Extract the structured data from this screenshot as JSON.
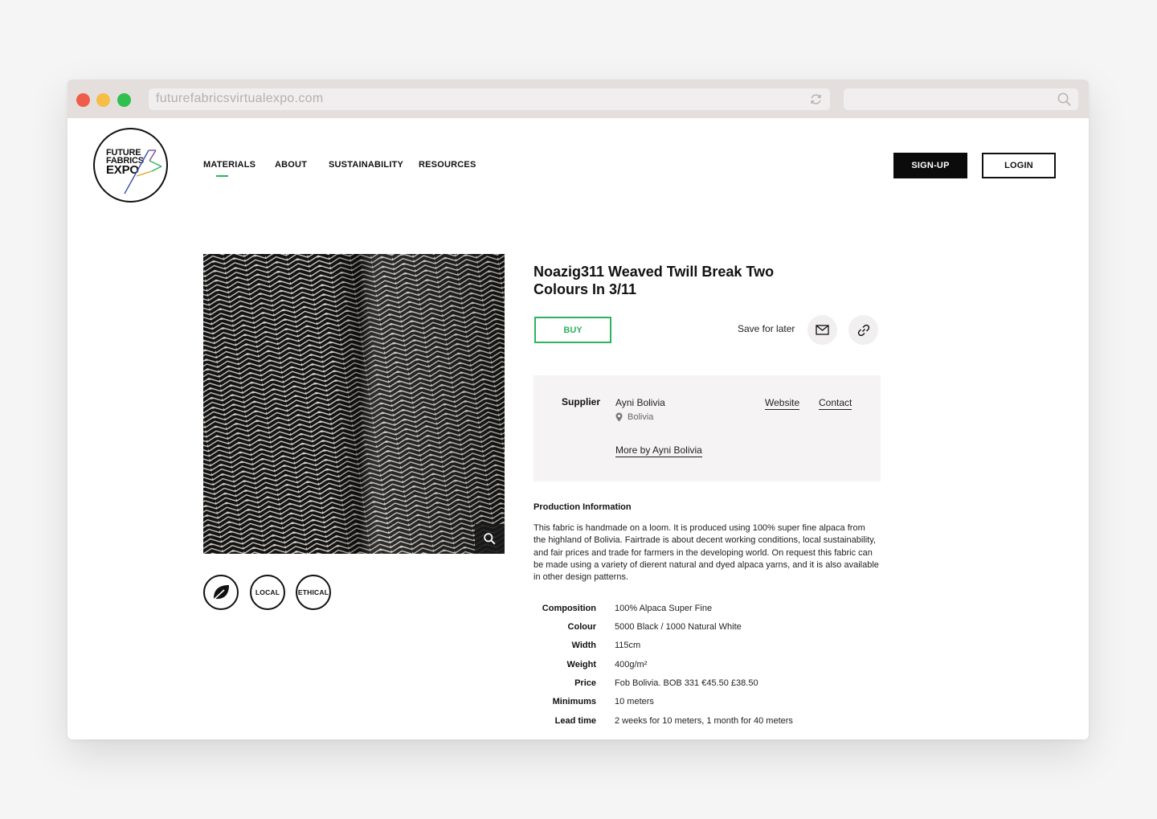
{
  "browser": {
    "url": "futurefabricsvirtualexpo.com"
  },
  "logo": {
    "line1": "FUTURE",
    "line2": "FABRICS",
    "line3": "EXPO"
  },
  "nav": {
    "items": [
      {
        "label": "MATERIALS",
        "active": true
      },
      {
        "label": "ABOUT",
        "active": false
      },
      {
        "label": "SUSTAINABILITY",
        "active": false
      },
      {
        "label": "RESOURCES",
        "active": false
      }
    ]
  },
  "header": {
    "signup_label": "SIGN-UP",
    "login_label": "LOGIN"
  },
  "product": {
    "title_line1": "Noazig311 Weaved Twill Break Two",
    "title_line2": "Colours In 3/11",
    "buy_label": "BUY",
    "save_label": "Save for later",
    "badges": [
      "leaf-icon",
      "LOCAL",
      "ETHICAL"
    ]
  },
  "supplier": {
    "label": "Supplier",
    "name": "Ayni Bolivia",
    "location": "Bolivia",
    "website_label": "Website",
    "contact_label": "Contact",
    "more_label": "More by Ayni Bolivia"
  },
  "production": {
    "heading": "Production Information",
    "description": "This fabric is handmade on a loom. It is produced using 100% super fine alpaca from the highland of Bolivia. Fairtrade is about decent working conditions, local sustainability, and fair prices and trade for farmers in the developing world. On request this fabric can be made using a variety of dierent natural and dyed alpaca yarns, and it is also available in other design patterns."
  },
  "specs": [
    {
      "label": "Composition",
      "value": "100% Alpaca Super Fine"
    },
    {
      "label": "Colour",
      "value": "5000 Black / 1000 Natural White"
    },
    {
      "label": "Width",
      "value": "115cm"
    },
    {
      "label": "Weight",
      "value": "400g/m²"
    },
    {
      "label": "Price",
      "value": "Fob Bolivia. BOB 331 €45.50 £38.50"
    },
    {
      "label": "Minimums",
      "value": "10 meters"
    },
    {
      "label": "Lead time",
      "value": "2 weeks for 10 meters, 1 month for 40 meters"
    }
  ],
  "colors": {
    "accent_green": "#2db35d",
    "panel_bg": "#f5f3f3"
  }
}
